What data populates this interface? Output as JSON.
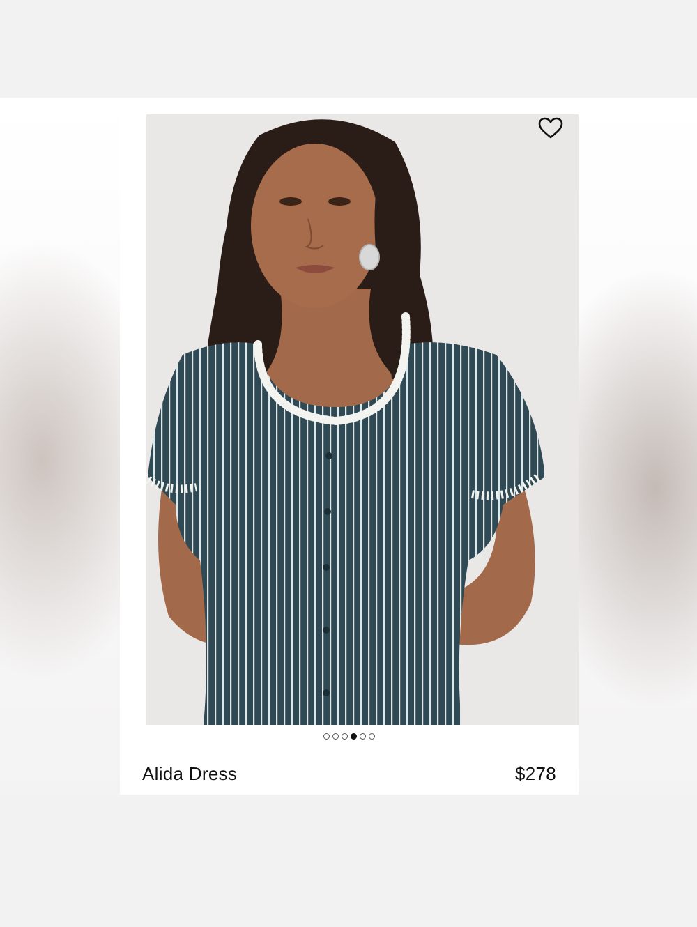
{
  "product": {
    "name": "Alida Dress",
    "price": "$278",
    "image_alt": "Model wearing striped dress with lace trim"
  },
  "carousel": {
    "total": 6,
    "active_index": 3
  },
  "favorite": {
    "icon": "heart-outline-icon"
  },
  "colors": {
    "dress": "#2f4a54",
    "stripe": "#dfe7e8",
    "lace": "#f3f3ef",
    "skin": "#a2694a",
    "hair": "#2a1c16",
    "background": "#eae8e6"
  }
}
